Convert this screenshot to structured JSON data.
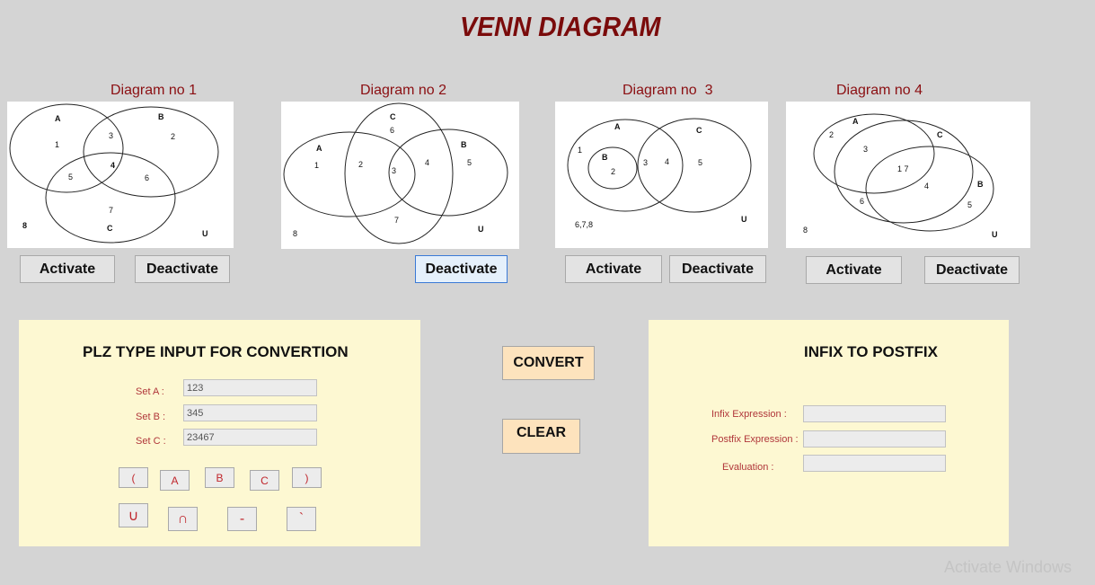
{
  "title": "VENN DIAGRAM",
  "diagrams": [
    {
      "label": "Diagram no 1",
      "region_text": {
        "A": "A",
        "B": "B",
        "C": "C",
        "r1": "1",
        "r2": "2",
        "r3": "3",
        "r4": "4",
        "r5": "5",
        "r6": "6",
        "r7": "7",
        "outside": "8",
        "U": "U"
      },
      "activate": "Activate",
      "deactivate": "Deactivate"
    },
    {
      "label": "Diagram no 2",
      "region_text": {
        "A": "A",
        "B": "B",
        "C": "C",
        "r1": "1",
        "r2": "2",
        "r3": "3",
        "r4": "4",
        "r5": "5",
        "r6": "6",
        "r7": "7",
        "outside": "8",
        "U": "U"
      },
      "deactivate": "Deactivate"
    },
    {
      "label": "Diagram no  3",
      "region_text": {
        "A": "A",
        "B": "B",
        "C": "C",
        "r1": "1",
        "r2": "2",
        "r3": "3",
        "r4": "4",
        "r5": "5",
        "outside": "6,7,8",
        "U": "U"
      },
      "activate": "Activate",
      "deactivate": "Deactivate"
    },
    {
      "label": "Diagram no 4",
      "region_text": {
        "A": "A",
        "B": "B",
        "C": "C",
        "r2": "2",
        "r3": "3",
        "r17": "1 7",
        "r4": "4",
        "r5": "5",
        "r6": "6",
        "outside": "8",
        "U": "U"
      },
      "activate": "Activate",
      "deactivate": "Deactivate"
    }
  ],
  "input_card": {
    "title": "PLZ TYPE INPUT FOR CONVERTION",
    "set_a_label": "Set A :",
    "set_a_value": "123",
    "set_b_label": "Set B :",
    "set_b_value": "345",
    "set_c_label": "Set C :",
    "set_c_value": "23467",
    "buttons_row1": [
      "(",
      "A",
      "B",
      "C",
      ")"
    ],
    "buttons_row2": [
      "∪",
      "∩",
      "-",
      "`"
    ]
  },
  "actions": {
    "convert": "CONVERT",
    "clear": "CLEAR"
  },
  "output_card": {
    "title": "INFIX TO POSTFIX",
    "infix_label": "Infix Expression :",
    "postfix_label": "Postfix Expression :",
    "evaluation_label": "Evaluation :",
    "infix_value": "",
    "postfix_value": "",
    "evaluation_value": ""
  },
  "watermark": "Activate Windows",
  "colors": {
    "background": "#d4d4d4",
    "title": "#7a0b0b",
    "label_red": "#8b0f12",
    "card": "#fdf8d2",
    "action_button": "#fde3bd"
  }
}
